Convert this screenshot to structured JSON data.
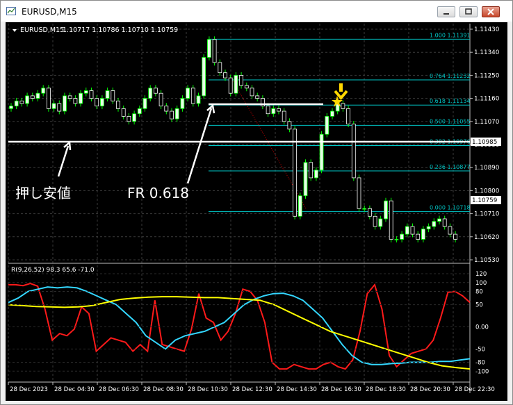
{
  "window": {
    "title": "EURUSD,M15",
    "minimize_icon": "minimize-icon",
    "restore_icon": "restore-icon",
    "close_icon": "close-icon"
  },
  "chart": {
    "header_symbol": "EURUSD,M15",
    "header_ohlc": "1.10717 1.10786 1.10710 1.10759",
    "price_axis_labels": [
      "1.11430",
      "1.11340",
      "1.11250",
      "1.11160",
      "1.11070",
      "1.10980",
      "1.10890",
      "1.10800",
      "1.10710",
      "1.10620",
      "1.10530"
    ],
    "current_price_label": "1.10759",
    "support_price_label": "1.10985",
    "time_axis_labels": [
      "28 Dec 2023",
      "28 Dec 04:30",
      "28 Dec 06:30",
      "28 Dec 08:30",
      "28 Dec 10:30",
      "28 Dec 12:30",
      "28 Dec 14:30",
      "28 Dec 16:30",
      "28 Dec 18:30",
      "28 Dec 20:30",
      "28 Dec 22:30"
    ],
    "fibonacci": [
      {
        "label": "1.000  1.11391"
      },
      {
        "label": "0.764  1.11232"
      },
      {
        "label": "0.618  1.11134"
      },
      {
        "label": "0.500  1.11055"
      },
      {
        "label": "0.382  1.10976"
      },
      {
        "label": "0.236  1.10877"
      },
      {
        "label": "0.000  1.10718"
      }
    ],
    "annotations": {
      "support_label": "押し安値",
      "fr_label": "FR 0.618"
    },
    "colors": {
      "bull_candle": "#e6ffe6",
      "bear_candle": "#ffffff",
      "wick": "#00ff00",
      "fib": "#00c8c8",
      "grid": "#3a3a3a",
      "arrow": "#ffd700",
      "rsi_fast": "#ff1a1a",
      "rsi_mid": "#33d6ff",
      "rsi_slow": "#ffff00"
    }
  },
  "indicator": {
    "header": "R(9,26,52) 98.3 65.6 -71.0",
    "axis_labels": [
      "120",
      "100",
      "80",
      "50",
      "0.00",
      "-50",
      "-80",
      "-100"
    ]
  },
  "chart_data": {
    "type": "candlestick",
    "series_name": "EURUSD,M15",
    "price_range": [
      1.1053,
      1.1143
    ],
    "last_ohlc": {
      "open": 1.10717,
      "high": 1.10786,
      "low": 1.1071,
      "close": 1.10759
    },
    "closes": [
      1.1113,
      1.1115,
      1.1114,
      1.1117,
      1.1116,
      1.1118,
      1.112,
      1.1112,
      1.1114,
      1.1111,
      1.1117,
      1.1116,
      1.1114,
      1.1118,
      1.1119,
      1.1116,
      1.1113,
      1.1116,
      1.1119,
      1.1115,
      1.1112,
      1.1109,
      1.1107,
      1.111,
      1.1112,
      1.1116,
      1.112,
      1.1118,
      1.1113,
      1.1111,
      1.1108,
      1.1112,
      1.1116,
      1.112,
      1.1114,
      1.1117,
      1.1132,
      1.1139,
      1.113,
      1.1126,
      1.1124,
      1.1118,
      1.1125,
      1.1121,
      1.112,
      1.1117,
      1.1116,
      1.1113,
      1.111,
      1.1112,
      1.1111,
      1.1107,
      1.1104,
      1.107,
      1.1078,
      1.1091,
      1.1085,
      1.1088,
      1.1102,
      1.1109,
      1.1111,
      1.1114,
      1.1112,
      1.1106,
      1.1085,
      1.1073,
      1.1073,
      1.107,
      1.1066,
      1.1069,
      1.1076,
      1.1061,
      1.1061,
      1.1063,
      1.1066,
      1.1063,
      1.1061,
      1.1065,
      1.1066,
      1.1068,
      1.1069,
      1.1066,
      1.1063,
      1.1061
    ],
    "fib_levels": [
      1.11391,
      1.11232,
      1.11134,
      1.11055,
      1.10976,
      1.10877,
      1.10718
    ],
    "support_level": 1.10985,
    "indicator_range": [
      -120,
      120
    ],
    "rsi_series": [
      {
        "name": "R9",
        "values": [
          95,
          95,
          93,
          98,
          92,
          40,
          -30,
          -15,
          -20,
          -5,
          45,
          30,
          -55,
          -40,
          -25,
          -30,
          -35,
          -55,
          -40,
          -55,
          60,
          -40,
          -45,
          -50,
          -55,
          -5,
          75,
          20,
          10,
          -30,
          -10,
          30,
          85,
          80,
          60,
          10,
          -80,
          -95,
          -95,
          -85,
          -90,
          -95,
          -95,
          -85,
          -80,
          -90,
          -95,
          -75,
          -10,
          75,
          95,
          40,
          -65,
          -90,
          -75,
          -60,
          -55,
          -50,
          -30,
          20,
          78,
          80,
          70,
          55
        ]
      },
      {
        "name": "R26",
        "values": [
          55,
          65,
          80,
          85,
          90,
          88,
          90,
          88,
          80,
          70,
          60,
          50,
          30,
          10,
          -20,
          -35,
          -50,
          -30,
          -20,
          -15,
          -10,
          0,
          10,
          30,
          50,
          62,
          70,
          75,
          76,
          70,
          60,
          40,
          20,
          -10,
          -40,
          -65,
          -80,
          -85,
          -85,
          -83,
          -82,
          -80,
          -80,
          -80,
          -78,
          -78,
          -75,
          -72
        ]
      },
      {
        "name": "R52",
        "values": [
          50,
          48,
          46,
          45,
          44,
          45,
          48,
          55,
          62,
          65,
          67,
          68,
          68,
          67,
          66,
          66,
          64,
          62,
          60,
          50,
          35,
          20,
          5,
          -10,
          -20,
          -30,
          -40,
          -50,
          -60,
          -70,
          -80,
          -88,
          -92,
          -95
        ]
      }
    ]
  }
}
